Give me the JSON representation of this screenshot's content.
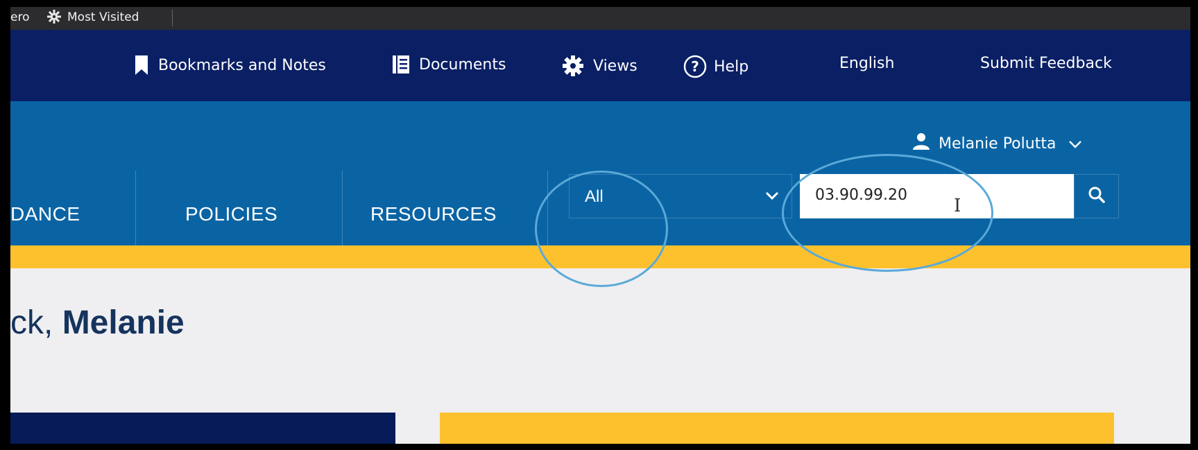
{
  "bookmarks_bar": {
    "truncated_item": "ero",
    "most_visited": "Most Visited"
  },
  "utility_nav": {
    "bookmarks": "Bookmarks and Notes",
    "documents": "Documents",
    "views": "Views",
    "help": "Help",
    "language": "English",
    "feedback": "Submit Feedback"
  },
  "header": {
    "user_name": "Melanie Polutta",
    "nav": [
      "DANCE",
      "POLICIES",
      "RESOURCES"
    ],
    "search": {
      "scope_value": "All",
      "query": "03.90.99.20"
    }
  },
  "main": {
    "greeting_prefix": "ck,",
    "greeting_name": "Melanie"
  },
  "colors": {
    "utility_bg": "#0a1f64",
    "header_bg": "#0a64a4",
    "accent_yellow": "#fdc12e",
    "annotation_ring": "#5aa9d8"
  }
}
